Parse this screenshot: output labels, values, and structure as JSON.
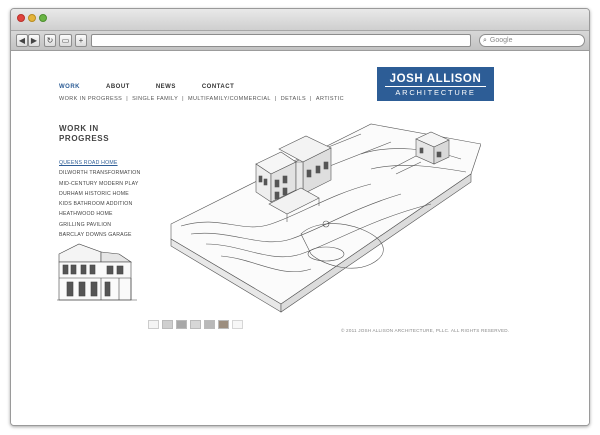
{
  "browser": {
    "search_placeholder": "Google",
    "back_glyph": "◀",
    "forward_glyph": "▶",
    "reload_glyph": "↻",
    "bookmark_glyph": "▭",
    "add_glyph": "+",
    "search_icon_glyph": "⌕"
  },
  "site": {
    "logo_line1": "JOSH ALLISON",
    "logo_line2": "ARCHITECTURE",
    "nav": [
      "WORK",
      "ABOUT",
      "NEWS",
      "CONTACT"
    ],
    "subnav": [
      "WORK IN PROGRESS",
      "|",
      "SINGLE FAMILY",
      "|",
      "MULTIFAMILY/COMMERCIAL",
      "|",
      "DETAILS",
      "|",
      "ARTISTIC"
    ],
    "section_title": "WORK IN PROGRESS",
    "projects": [
      "QUEENS ROAD HOME",
      "DILWORTH TRANSFORMATION",
      "MID-CENTURY MODERN PLAY",
      "DURHAM HISTORIC HOME",
      "KIDS BATHROOM ADDITION",
      "HEATHWOOD HOME",
      "GRILLING PAVILION",
      "BARCLAY DOWNS GARAGE"
    ],
    "mini_label": "«",
    "copyright": "© 2011 JOSH ALLISON ARCHITECTURE, PLLC. ALL RIGHTS RESERVED."
  },
  "colors": {
    "accent": "#2d5d96"
  }
}
